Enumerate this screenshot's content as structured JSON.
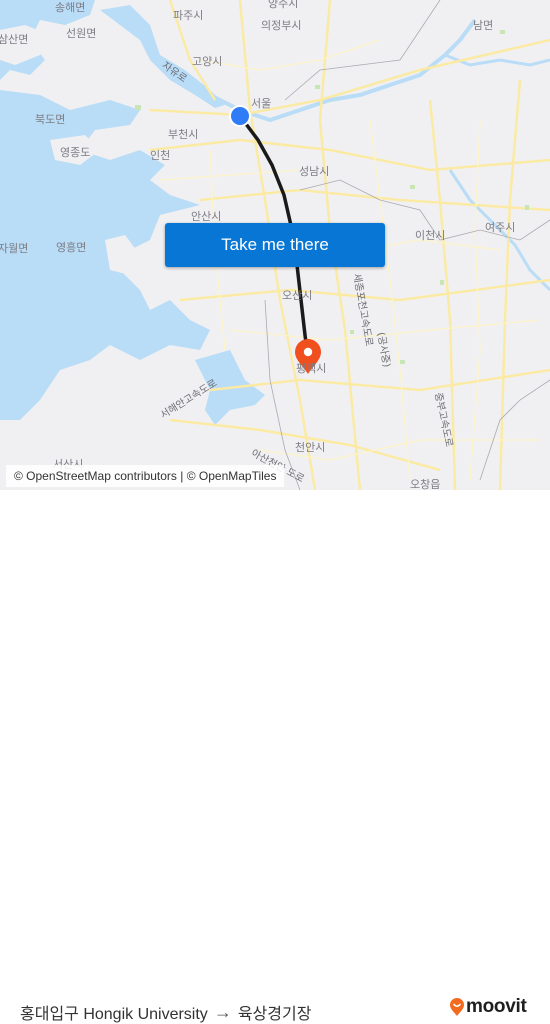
{
  "map": {
    "labels": [
      {
        "name": "songhae-myeon",
        "text": "송해면"
      },
      {
        "name": "samsan-myeon",
        "text": "삼산면"
      },
      {
        "name": "seonwon-myeon",
        "text": "선원면"
      },
      {
        "name": "paju-si",
        "text": "파주시"
      },
      {
        "name": "yangju-si",
        "text": "양주시"
      },
      {
        "name": "uijeongbu-si",
        "text": "의정부시"
      },
      {
        "name": "nam-myeon",
        "text": "남면"
      },
      {
        "name": "goyang-si",
        "text": "고양시"
      },
      {
        "name": "seoul",
        "text": "서울"
      },
      {
        "name": "bukdo-myeon",
        "text": "북도면"
      },
      {
        "name": "bucheon-si",
        "text": "부천시"
      },
      {
        "name": "yeongjong-do",
        "text": "영종도"
      },
      {
        "name": "incheon",
        "text": "인천"
      },
      {
        "name": "seongnam-si",
        "text": "성남시"
      },
      {
        "name": "ansan-si",
        "text": "안산시"
      },
      {
        "name": "jawol-myeon",
        "text": "자월면"
      },
      {
        "name": "yeongheung-myeon",
        "text": "영흥면"
      },
      {
        "name": "icheon-si",
        "text": "이천시"
      },
      {
        "name": "yeoju-si",
        "text": "여주시"
      },
      {
        "name": "osan-si",
        "text": "오산시"
      },
      {
        "name": "pyeongtaek-si",
        "text": "평택시"
      },
      {
        "name": "cheonan-si",
        "text": "천안시"
      },
      {
        "name": "ochang-eup",
        "text": "오창읍"
      },
      {
        "name": "seosan-si",
        "text": "서산시"
      }
    ],
    "roads": [
      {
        "name": "jayu-ro",
        "text": "자유로"
      },
      {
        "name": "seohaean-expressway",
        "text": "서해안고속도로"
      },
      {
        "name": "sejong-pocheon-expressway",
        "text": "세종포천고속도로"
      },
      {
        "name": "gongsa-jung",
        "text": "(공사중)"
      },
      {
        "name": "jungbu-expressway",
        "text": "중부고속도로"
      },
      {
        "name": "asan-cheongju-road",
        "text": "아산천안 도로"
      }
    ],
    "origin_marker_color": "#2f7cf6",
    "destination_marker_color": "#f0501e",
    "route_color": "#1a1a1a"
  },
  "cta": {
    "label": "Take me there"
  },
  "attribution": "© OpenStreetMap contributors | © OpenMapTiles",
  "route": {
    "origin": "홍대입구 Hongik University",
    "arrow": "→",
    "destination": "육상경기장"
  },
  "brand": {
    "name": "moovit",
    "accent": "#f26b21"
  }
}
